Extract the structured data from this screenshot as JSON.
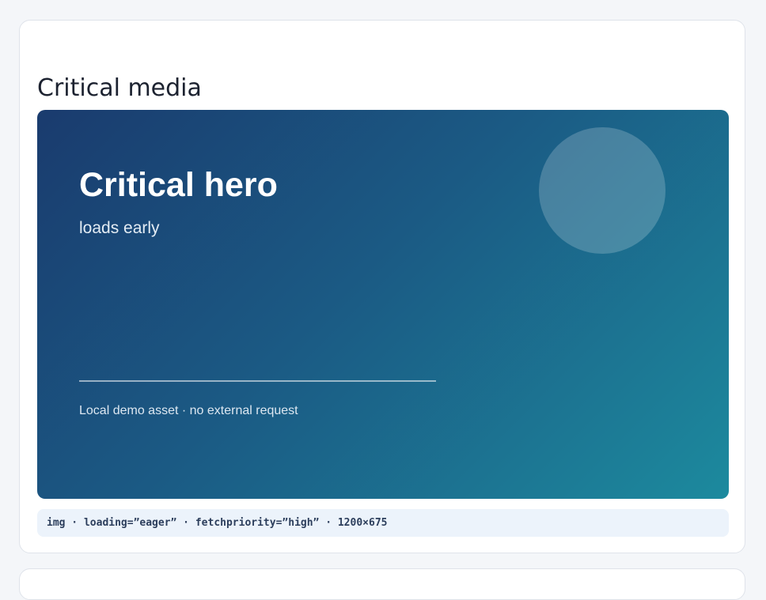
{
  "section": {
    "title": "Critical media"
  },
  "hero": {
    "title": "Critical hero",
    "subtitle": "loads early",
    "caption": "Local demo asset · no external request",
    "image_alt": "Critical hero"
  },
  "meta": {
    "text": "img · loading=”eager” · fetchpriority=”high” · 1200×675"
  },
  "colors": {
    "gradient_start": "#1a3b6e",
    "gradient_mid": "#1b5a84",
    "gradient_end": "#1c8a9e",
    "meta_bg": "#ecf3fb",
    "meta_text": "#2c3e5c"
  }
}
